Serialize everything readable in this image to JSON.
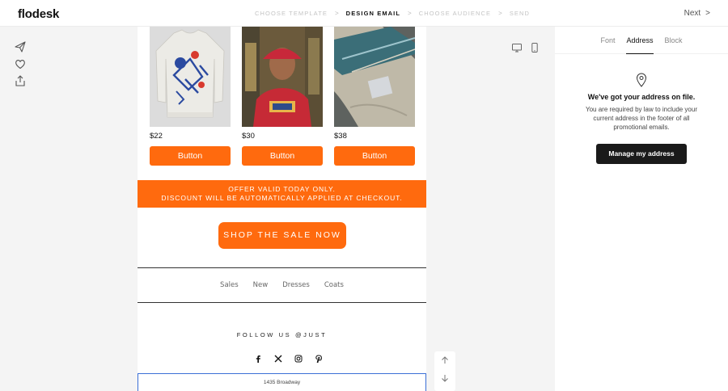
{
  "app": {
    "logo": "flodesk"
  },
  "steps": [
    {
      "label": "CHOOSE TEMPLATE",
      "active": false
    },
    {
      "label": "DESIGN EMAIL",
      "active": true
    },
    {
      "label": "CHOOSE AUDIENCE",
      "active": false
    },
    {
      "label": "SEND",
      "active": false
    }
  ],
  "step_separator": ">",
  "header": {
    "next_label": "Next",
    "next_chevron": ">"
  },
  "left_tools": [
    "send-icon",
    "heart-icon",
    "share-icon"
  ],
  "email": {
    "products": [
      {
        "price": "$22",
        "button": "Button",
        "image": "sweater-image"
      },
      {
        "price": "$30",
        "button": "Button",
        "image": "model-image"
      },
      {
        "price": "$38",
        "button": "Button",
        "image": "fabric-image"
      }
    ],
    "offer_line1": "OFFER VALID TODAY ONLY.",
    "offer_line2": "DISCOUNT WILL BE AUTOMATICALLY APPLIED AT CHECKOUT.",
    "cta": "SHOP THE SALE NOW",
    "nav": [
      "Sales",
      "New",
      "Dresses",
      "Coats"
    ],
    "follow": "FOLLOW US @JUST",
    "socials": [
      "facebook-icon",
      "x-icon",
      "instagram-icon",
      "pinterest-icon"
    ],
    "address": "1435 Broadway"
  },
  "colors": {
    "accent": "#ff6a0e",
    "selection": "#3b6fd6",
    "dark_button": "#1a1a1a"
  },
  "panel": {
    "tabs": [
      {
        "label": "Font",
        "active": false
      },
      {
        "label": "Address",
        "active": true
      },
      {
        "label": "Block",
        "active": false
      }
    ],
    "title": "We've got your address on file.",
    "body": "You are required by law to include your current address in the footer of all promotional emails.",
    "button": "Manage my address"
  }
}
